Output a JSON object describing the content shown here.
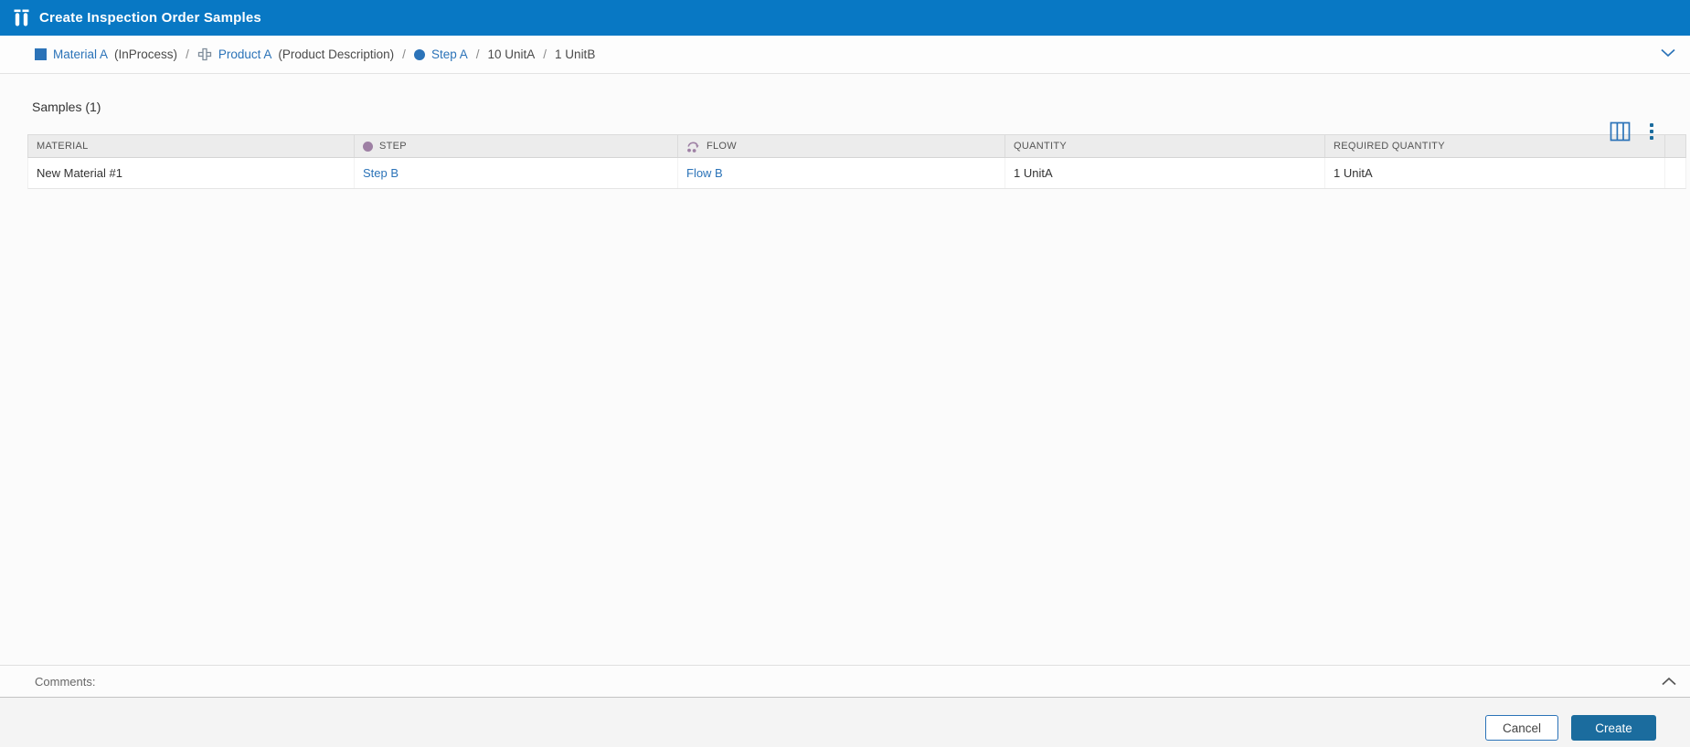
{
  "colors": {
    "titlebar_blue": "#0878C4",
    "link_blue": "#2B73B8",
    "primary_button": "#1B6C9E",
    "step_purple": "#9E80A4",
    "header_bg": "#ECECEC"
  },
  "icons": {
    "app": "test-tubes-icon",
    "material": "blue-square-icon",
    "product": "assembly-cross-icon",
    "step": "circle-icon",
    "flow": "loop-arrow-dots-icon",
    "column_chooser": "columns-icon",
    "menu": "kebab-vertical-icon",
    "breadcrumb_expand": "chevron-down-icon",
    "comments_toggle": "chevron-up-icon"
  },
  "titlebar": {
    "title": "Create Inspection Order Samples"
  },
  "breadcrumb": {
    "material_label": "Material A",
    "material_detail": "(InProcess)",
    "sep": "/",
    "product_label": "Product A",
    "product_detail": "(Product Description)",
    "step_label": "Step A",
    "primary_quantity": "10 UnitA",
    "secondary_quantity": "1 UnitB"
  },
  "samples": {
    "section_title": "Samples (1)",
    "columns": [
      "MATERIAL",
      "STEP",
      "FLOW",
      "QUANTITY",
      "REQUIRED QUANTITY"
    ],
    "rows": [
      {
        "material": "New Material #1",
        "step": "Step B",
        "flow": "Flow B",
        "quantity": "1 UnitA",
        "required_quantity": "1 UnitA"
      }
    ]
  },
  "comments": {
    "label": "Comments:"
  },
  "footer": {
    "cancel_label": "Cancel",
    "create_label": "Create"
  }
}
